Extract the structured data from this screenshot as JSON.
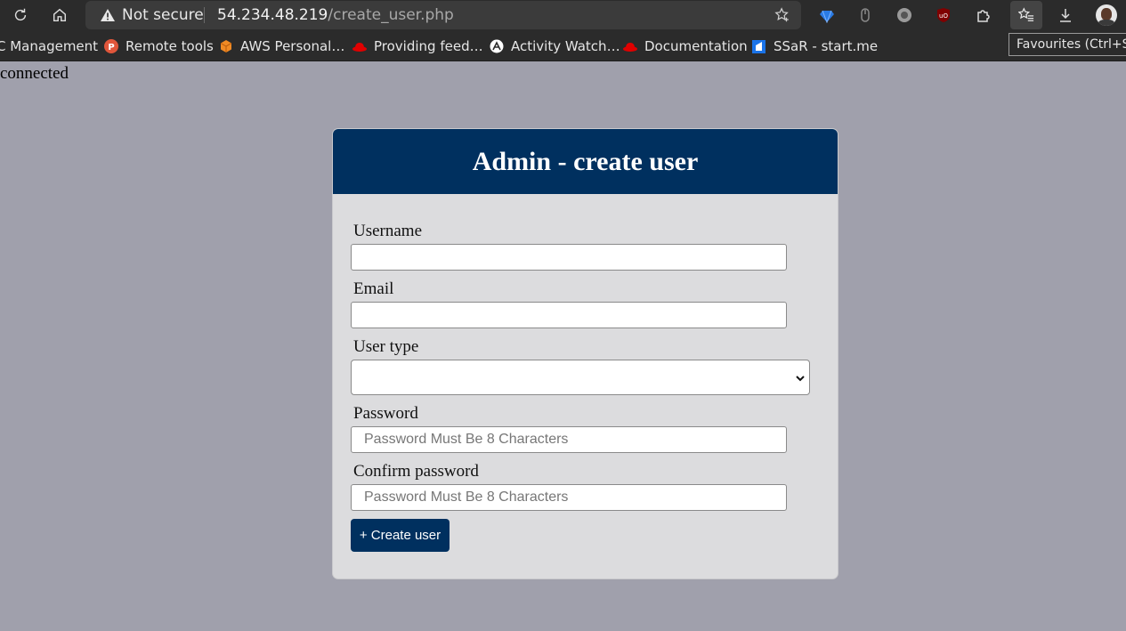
{
  "browser": {
    "security_label": "Not secure",
    "url_host": "54.234.48.219",
    "url_path": "/create_user.php",
    "tooltip": "Favourites (Ctrl+Shift+O)",
    "bookmarks": [
      {
        "label": "C Management",
        "icon": "none"
      },
      {
        "label": "Remote tools",
        "icon": "p-badge-icon",
        "color": "#e0563b"
      },
      {
        "label": "AWS Personal…",
        "icon": "aws-cube-icon",
        "color": "#f08a24"
      },
      {
        "label": "Providing feed…",
        "icon": "redhat-icon",
        "color": "#e00000"
      },
      {
        "label": "Activity Watch…",
        "icon": "activitywatch-icon",
        "color": "#ffffff"
      },
      {
        "label": "Documentation",
        "icon": "redhat-icon",
        "color": "#e00000"
      },
      {
        "label": "SSaR - start.me",
        "icon": "startme-icon",
        "color": "#1a73e8"
      }
    ]
  },
  "page": {
    "status_text": "connected",
    "form": {
      "title": "Admin - create user",
      "username_label": "Username",
      "username_value": "",
      "email_label": "Email",
      "email_value": "",
      "user_type_label": "User type",
      "user_type_value": "",
      "password_label": "Password",
      "password_placeholder": "Password Must Be 8 Characters",
      "confirm_label": "Confirm password",
      "confirm_placeholder": "Password Must Be 8 Characters",
      "submit_label": "+ Create user"
    }
  },
  "colors": {
    "page_bg": "#a0a0ac",
    "header_bg": "#00305f",
    "card_bg": "#dcdcde",
    "button_bg": "#00305f"
  }
}
